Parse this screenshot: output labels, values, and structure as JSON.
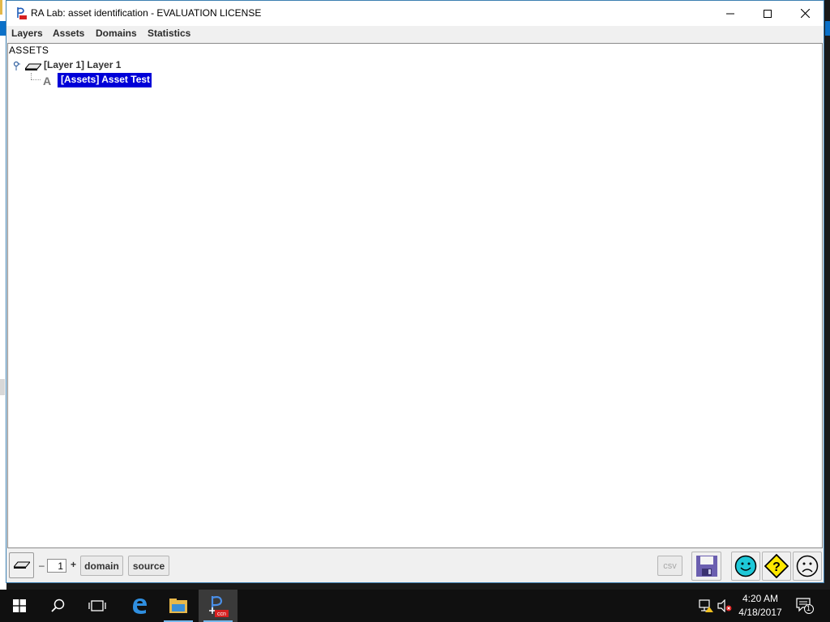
{
  "window": {
    "title": "RA Lab: asset identification - EVALUATION LICENSE"
  },
  "menu": {
    "items": [
      "Layers",
      "Assets",
      "Domains",
      "Statistics"
    ]
  },
  "tree": {
    "root_label": "ASSETS",
    "layer_label": "[Layer 1] Layer 1",
    "asset_label": "[Assets] Asset Test",
    "asset_icon_letter": "A",
    "selected_color": "#0000d8"
  },
  "bottombar": {
    "minus": "–",
    "layer_number": "1",
    "plus": "+",
    "domain_label": "domain",
    "source_label": "source",
    "csv_label": "csv"
  },
  "taskbar": {
    "time": "4:20 AM",
    "date": "4/18/2017",
    "notification_count": "1",
    "app_badge_text": "ccn"
  },
  "icons": [
    "app-logo-icon",
    "minimize-icon",
    "maximize-icon",
    "close-icon",
    "tree-handle-icon",
    "layer-icon",
    "asset-icon",
    "layer-button-icon",
    "save-disk-icon",
    "smiley-icon",
    "question-diamond-icon",
    "frown-icon",
    "windows-start-icon",
    "search-icon",
    "task-view-icon",
    "edge-icon",
    "file-explorer-icon",
    "ralab-taskbar-icon",
    "network-icon",
    "volume-muted-icon",
    "action-center-icon"
  ]
}
